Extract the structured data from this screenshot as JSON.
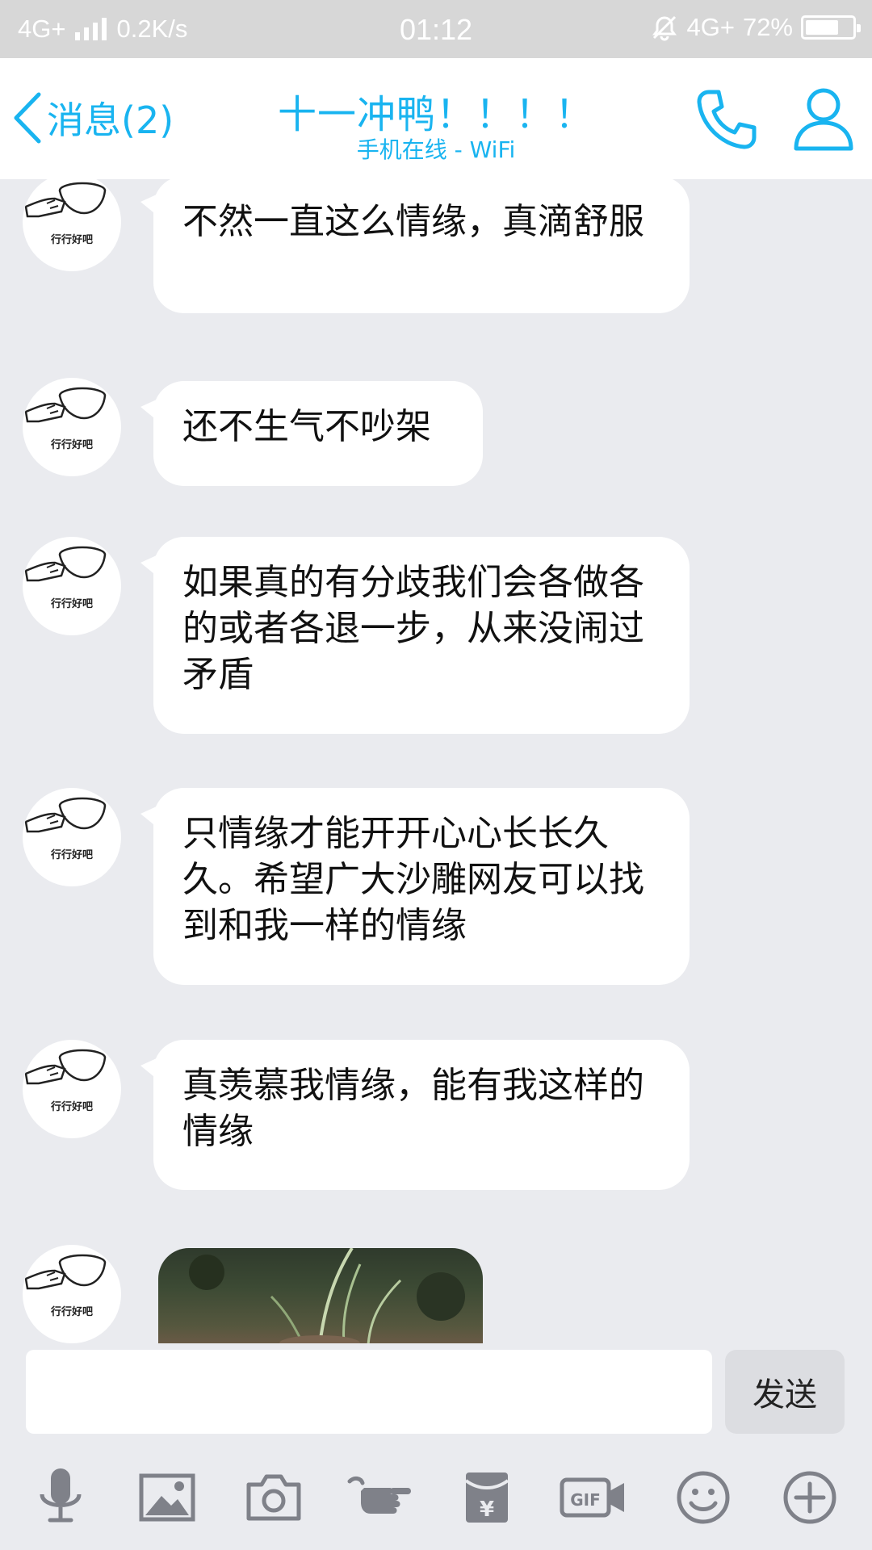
{
  "status_bar": {
    "network_left": "4G+",
    "speed": "0.2K/s",
    "time": "01:12",
    "network_right": "4G+",
    "battery": "72%",
    "battery_level": 0.72
  },
  "header": {
    "back_label": "消息(2)",
    "title": "十一冲鸭！！！！",
    "subtitle": "手机在线 - WiFi",
    "accent_color": "#19b4f0"
  },
  "avatar_caption": "行行好吧",
  "messages": [
    {
      "text": "不然一直这么情缘，真滴舒服"
    },
    {
      "text": "还不生气不吵架"
    },
    {
      "text": "如果真的有分歧我们会各做各的或者各退一步，从来没闹过矛盾"
    },
    {
      "text": "只情缘才能开开心心长长久久。希望广大沙雕网友可以找到和我一样的情缘"
    },
    {
      "text": "真羡慕我情缘，能有我这样的情缘"
    },
    {
      "type": "image"
    }
  ],
  "input": {
    "placeholder": "",
    "send_label": "发送"
  },
  "toolbar": [
    {
      "icon": "microphone-icon"
    },
    {
      "icon": "image-icon"
    },
    {
      "icon": "camera-icon"
    },
    {
      "icon": "poke-icon"
    },
    {
      "icon": "red-packet-icon"
    },
    {
      "icon": "gif-icon"
    },
    {
      "icon": "emoji-icon"
    },
    {
      "icon": "plus-icon"
    }
  ]
}
